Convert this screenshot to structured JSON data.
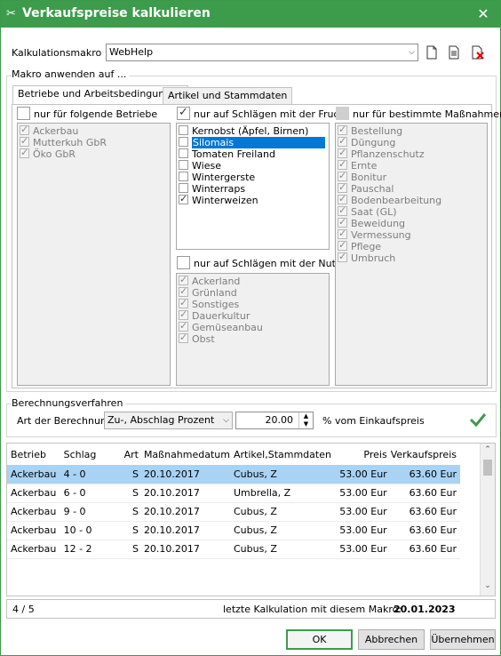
{
  "window": {
    "title": "Verkaufspreise kalkulieren",
    "close": "✕"
  },
  "makro": {
    "label": "Kalkulationsmakro",
    "value": "WebHelp"
  },
  "section_apply": {
    "label": "Makro anwenden auf ..."
  },
  "tabs": [
    "Betriebe und Arbeitsbedingungen",
    "Artikel und Stammdaten"
  ],
  "betriebe": {
    "checkbox_label": "nur für folgende Betriebe",
    "checked": false,
    "items": [
      "Ackerbau",
      "Mutterkuh GbR",
      "Öko GbR"
    ]
  },
  "frucht": {
    "checkbox_label": "nur auf Schlägen mit der Frucht",
    "checked": true,
    "items": [
      {
        "label": "Kernobst (Äpfel, Birnen)",
        "checked": false,
        "selected": false
      },
      {
        "label": "Silomais",
        "checked": false,
        "selected": true
      },
      {
        "label": "Tomaten Freiland",
        "checked": false,
        "selected": false
      },
      {
        "label": "Wiese",
        "checked": false,
        "selected": false
      },
      {
        "label": "Wintergerste",
        "checked": false,
        "selected": false
      },
      {
        "label": "Winterraps",
        "checked": false,
        "selected": false
      },
      {
        "label": "Winterweizen",
        "checked": true,
        "selected": false
      }
    ]
  },
  "nutzart": {
    "checkbox_label": "nur auf Schlägen mit der Nutzar",
    "checked": false,
    "items": [
      "Ackerland",
      "Grünland",
      "Sonstiges",
      "Dauerkultur",
      "Gemüseanbau",
      "Obst"
    ]
  },
  "massnahmen": {
    "checkbox_label": "nur für bestimmte Maßnahmen",
    "checked": false,
    "items": [
      "Bestellung",
      "Düngung",
      "Pflanzenschutz",
      "Ernte",
      "Bonitur",
      "Pauschal",
      "Bodenbearbeitung",
      "Saat (GL)",
      "Beweidung",
      "Vermessung",
      "Pflege",
      "Umbruch"
    ]
  },
  "berechnung": {
    "section_label": "Berechnungsverfahren",
    "art_label": "Art der Berechnung",
    "art_value": "Zu-, Abschlag Prozent",
    "amount": "20.00",
    "unit_label": "% vom Einkaufspreis"
  },
  "table": {
    "columns": [
      "Betrieb",
      "Schlag",
      "Art",
      "Maßnahmedatum",
      "Artikel,Stammdaten",
      "Preis",
      "Verkaufspreis"
    ],
    "rows": [
      [
        "Ackerbau",
        "4 - 0",
        "S",
        "20.10.2017",
        "Cubus, Z",
        "53.00 Eur",
        "63.60 Eur"
      ],
      [
        "Ackerbau",
        "6 - 0",
        "S",
        "20.10.2017",
        "Umbrella, Z",
        "53.00 Eur",
        "63.60 Eur"
      ],
      [
        "Ackerbau",
        "9 - 0",
        "S",
        "20.10.2017",
        "Cubus, Z",
        "53.00 Eur",
        "63.60 Eur"
      ],
      [
        "Ackerbau",
        "10 - 0",
        "S",
        "20.10.2017",
        "Cubus, Z",
        "53.00 Eur",
        "63.60 Eur"
      ],
      [
        "Ackerbau",
        "12 - 2",
        "S",
        "20.10.2017",
        "Cubus, Z",
        "53.00 Eur",
        "63.60 Eur"
      ]
    ]
  },
  "status": {
    "count": "4 / 5",
    "last_label": "letzte Kalkulation mit diesem Makro:",
    "last_date": "20.01.2023"
  },
  "buttons": {
    "ok": "OK",
    "cancel": "Abbrechen",
    "apply": "Übernehmen"
  },
  "colors": {
    "titlebar": "#3d9b4c",
    "selection": "#0078d7",
    "row_selected": "#a8d3f5",
    "check": "#3d9b4c"
  }
}
